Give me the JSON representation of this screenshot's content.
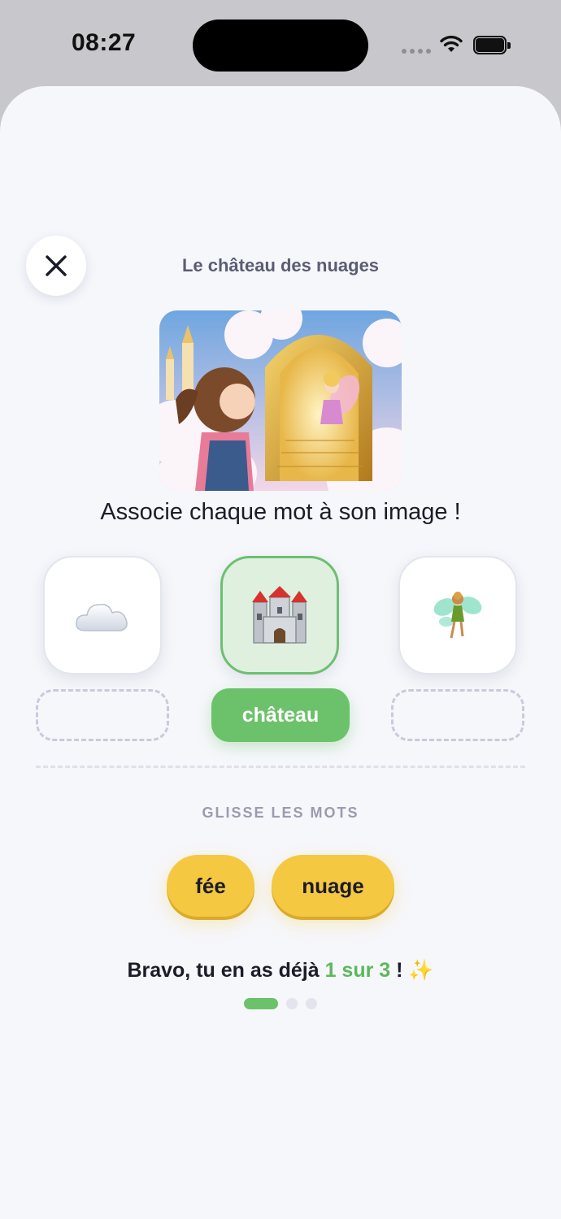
{
  "status_bar": {
    "time": "08:27"
  },
  "header": {
    "title": "Le château des nuages",
    "close_icon": "close-icon"
  },
  "instruction": "Associe chaque mot à son image !",
  "cards": [
    {
      "name": "cloud",
      "icon": "cloud-icon",
      "placed_word": ""
    },
    {
      "name": "castle",
      "icon": "castle-icon",
      "placed_word": "château",
      "matched": true
    },
    {
      "name": "fairy",
      "icon": "fairy-icon",
      "placed_word": ""
    }
  ],
  "word_bank": {
    "label": "GLISSE LES MOTS",
    "words": [
      "fée",
      "nuage"
    ]
  },
  "feedback": {
    "prefix": "Bravo, tu en as déjà ",
    "score": "1 sur 3",
    "suffix": " ! ",
    "sparkle": "✨"
  },
  "progress": {
    "current": 1,
    "total": 3
  },
  "colors": {
    "success": "#6cc26a",
    "chip": "#f5c842",
    "background": "#f6f7fb"
  }
}
